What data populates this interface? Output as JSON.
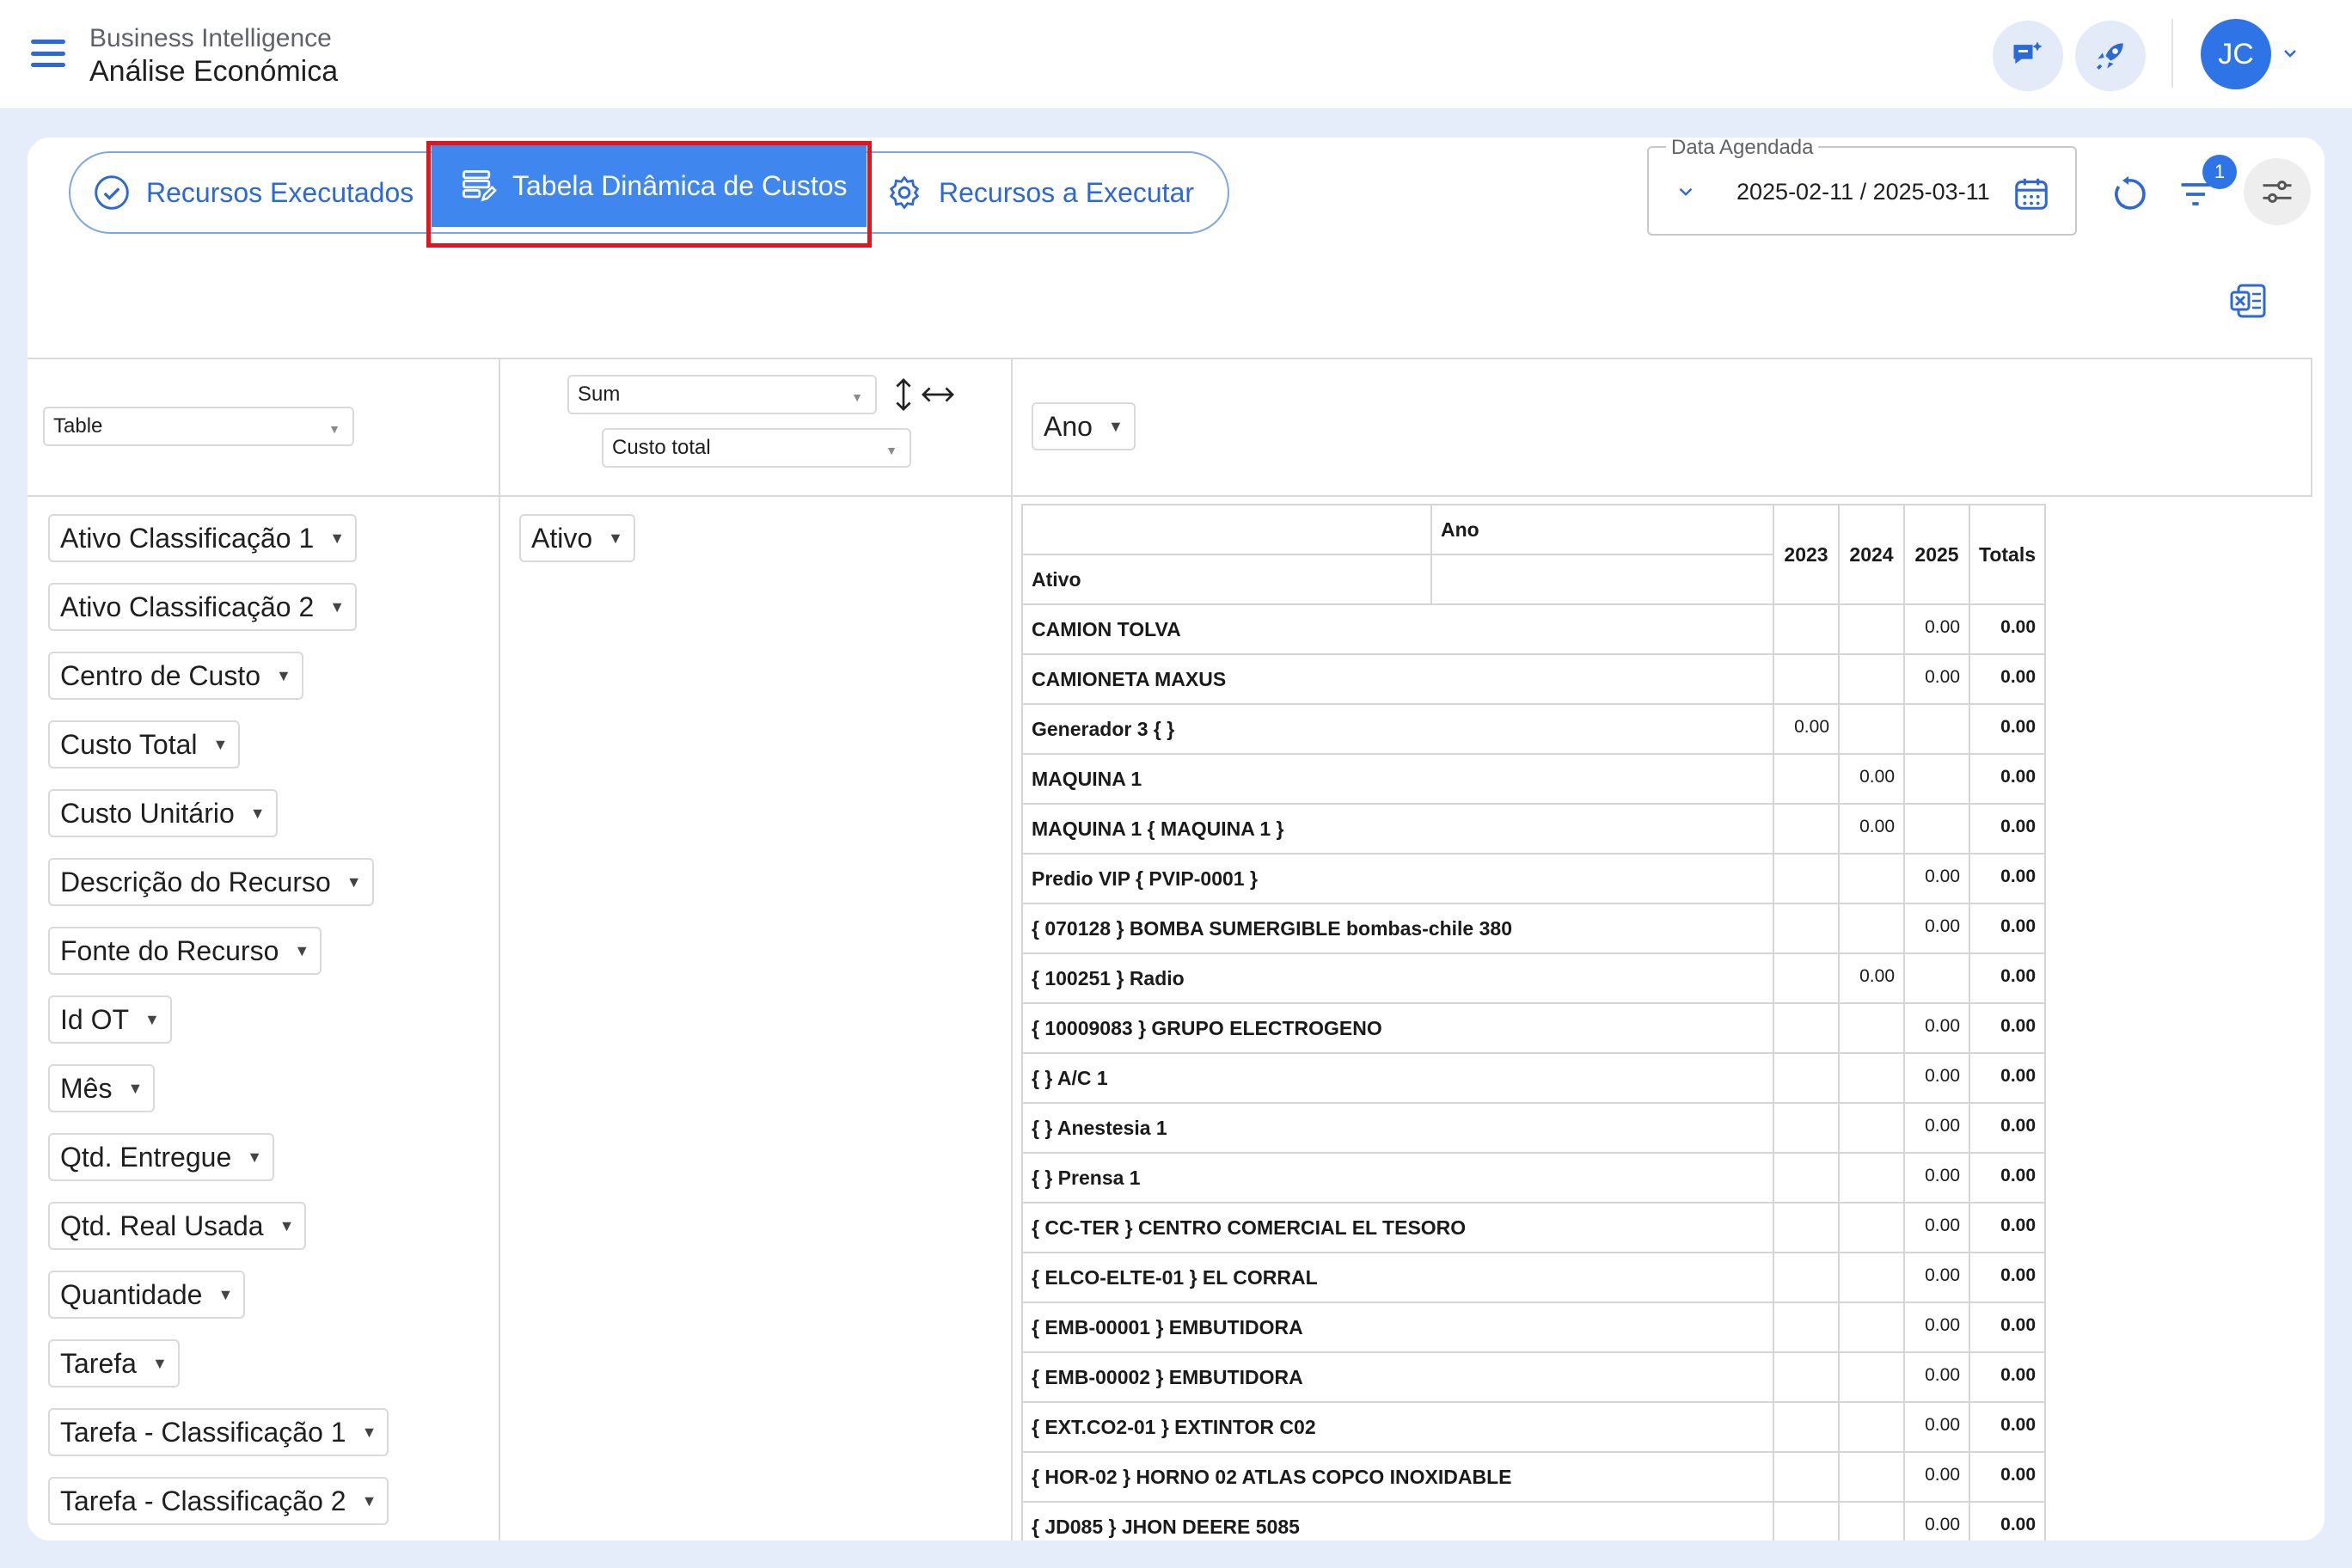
{
  "header": {
    "app_subtitle": "Business Intelligence",
    "app_title": "Análise Económica",
    "avatar_initials": "JC"
  },
  "tabs": [
    {
      "label": "Recursos Executados",
      "icon": "check-circle-icon",
      "active": false
    },
    {
      "label": "Tabela Dinâmica de Custos",
      "icon": "table-edit-icon",
      "active": true
    },
    {
      "label": "Recursos a Executar",
      "icon": "gear-icon",
      "active": false
    }
  ],
  "date_filter": {
    "label": "Data Agendada",
    "value": "2025-02-11 / 2025-03-11"
  },
  "filter_badge": "1",
  "pivot": {
    "renderer": "Table",
    "aggregator": "Sum",
    "value_field": "Custo total",
    "col_attr": "Ano",
    "row_attr": "Ativo",
    "attributes": [
      "Ativo Classificação 1",
      "Ativo Classificação 2",
      "Centro de Custo",
      "Custo Total",
      "Custo Unitário",
      "Descrição do Recurso",
      "Fonte do Recurso",
      "Id OT",
      "Mês",
      "Qtd. Entregue",
      "Qtd. Real Usada",
      "Quantidade",
      "Tarefa",
      "Tarefa - Classificação 1",
      "Tarefa - Classificação 2"
    ]
  },
  "table": {
    "col_header": "Ano",
    "row_header": "Ativo",
    "years": [
      "2023",
      "2024",
      "2025"
    ],
    "totals_label": "Totals",
    "rows": [
      {
        "name": "CAMION TOLVA",
        "y2023": "",
        "y2024": "",
        "y2025": "0.00",
        "total": "0.00"
      },
      {
        "name": "CAMIONETA MAXUS",
        "y2023": "",
        "y2024": "",
        "y2025": "0.00",
        "total": "0.00"
      },
      {
        "name": "Generador 3 { }",
        "y2023": "0.00",
        "y2024": "",
        "y2025": "",
        "total": "0.00"
      },
      {
        "name": "MAQUINA 1",
        "y2023": "",
        "y2024": "0.00",
        "y2025": "",
        "total": "0.00"
      },
      {
        "name": "MAQUINA 1 { MAQUINA 1 }",
        "y2023": "",
        "y2024": "0.00",
        "y2025": "",
        "total": "0.00"
      },
      {
        "name": "Predio VIP { PVIP-0001 }",
        "y2023": "",
        "y2024": "",
        "y2025": "0.00",
        "total": "0.00"
      },
      {
        "name": "{ 070128 } BOMBA SUMERGIBLE bombas-chile 380",
        "y2023": "",
        "y2024": "",
        "y2025": "0.00",
        "total": "0.00"
      },
      {
        "name": "{ 100251 } Radio",
        "y2023": "",
        "y2024": "0.00",
        "y2025": "",
        "total": "0.00"
      },
      {
        "name": "{ 10009083 } GRUPO ELECTROGENO",
        "y2023": "",
        "y2024": "",
        "y2025": "0.00",
        "total": "0.00"
      },
      {
        "name": "{ } A/C 1",
        "y2023": "",
        "y2024": "",
        "y2025": "0.00",
        "total": "0.00"
      },
      {
        "name": "{ } Anestesia 1",
        "y2023": "",
        "y2024": "",
        "y2025": "0.00",
        "total": "0.00"
      },
      {
        "name": "{ } Prensa 1",
        "y2023": "",
        "y2024": "",
        "y2025": "0.00",
        "total": "0.00"
      },
      {
        "name": "{ CC-TER } CENTRO COMERCIAL EL TESORO",
        "y2023": "",
        "y2024": "",
        "y2025": "0.00",
        "total": "0.00"
      },
      {
        "name": "{ ELCO-ELTE-01 } EL CORRAL",
        "y2023": "",
        "y2024": "",
        "y2025": "0.00",
        "total": "0.00"
      },
      {
        "name": "{ EMB-00001 } EMBUTIDORA",
        "y2023": "",
        "y2024": "",
        "y2025": "0.00",
        "total": "0.00"
      },
      {
        "name": "{ EMB-00002 } EMBUTIDORA",
        "y2023": "",
        "y2024": "",
        "y2025": "0.00",
        "total": "0.00"
      },
      {
        "name": "{ EXT.CO2-01 } EXTINTOR C02",
        "y2023": "",
        "y2024": "",
        "y2025": "0.00",
        "total": "0.00"
      },
      {
        "name": "{ HOR-02 } HORNO 02 ATLAS COPCO INOXIDABLE",
        "y2023": "",
        "y2024": "",
        "y2025": "0.00",
        "total": "0.00"
      },
      {
        "name": "{ JD085 } JHON DEERE 5085",
        "y2023": "",
        "y2024": "",
        "y2025": "0.00",
        "total": "0.00"
      }
    ]
  },
  "colors": {
    "accent": "#2f74e6",
    "active_tab": "#3f86ef",
    "highlight": "#e3141b",
    "background": "#e5ecfa"
  }
}
